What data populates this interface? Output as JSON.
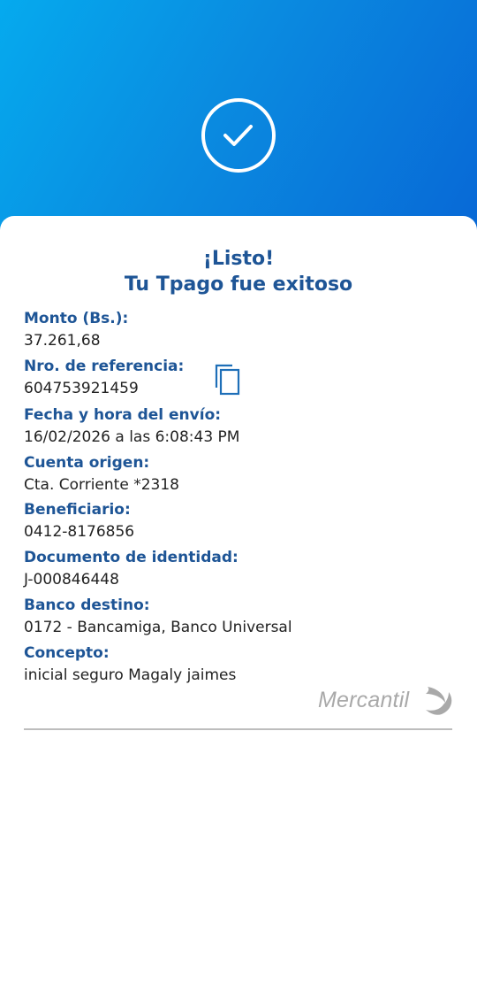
{
  "header": {
    "status_icon": "check-icon"
  },
  "title": {
    "line1": "¡Listo!",
    "line2": "Tu Tpago fue exitoso"
  },
  "fields": [
    {
      "label": "Monto (Bs.):",
      "value": "37.261,68"
    },
    {
      "label": "Nro. de referencia:",
      "value": "604753921459"
    },
    {
      "label": "Fecha y hora del envío:",
      "value": "16/02/2026 a las 6:08:43 PM"
    },
    {
      "label": "Cuenta origen:",
      "value": "Cta. Corriente *2318"
    },
    {
      "label": "Beneficiario:",
      "value": "0412-8176856"
    },
    {
      "label": "Documento de identidad:",
      "value": "J-000846448"
    },
    {
      "label": "Banco destino:",
      "value": "0172 - Bancamiga, Banco Universal"
    },
    {
      "label": "Concepto:",
      "value": "inicial seguro Magaly jaimes"
    }
  ],
  "logo": {
    "text": "Mercantil"
  },
  "colors": {
    "label": "#1e5596",
    "header_start": "#05aaee",
    "header_end": "#0868d6",
    "copy_icon": "#1e6fb8",
    "logo": "#a9a9a9"
  }
}
